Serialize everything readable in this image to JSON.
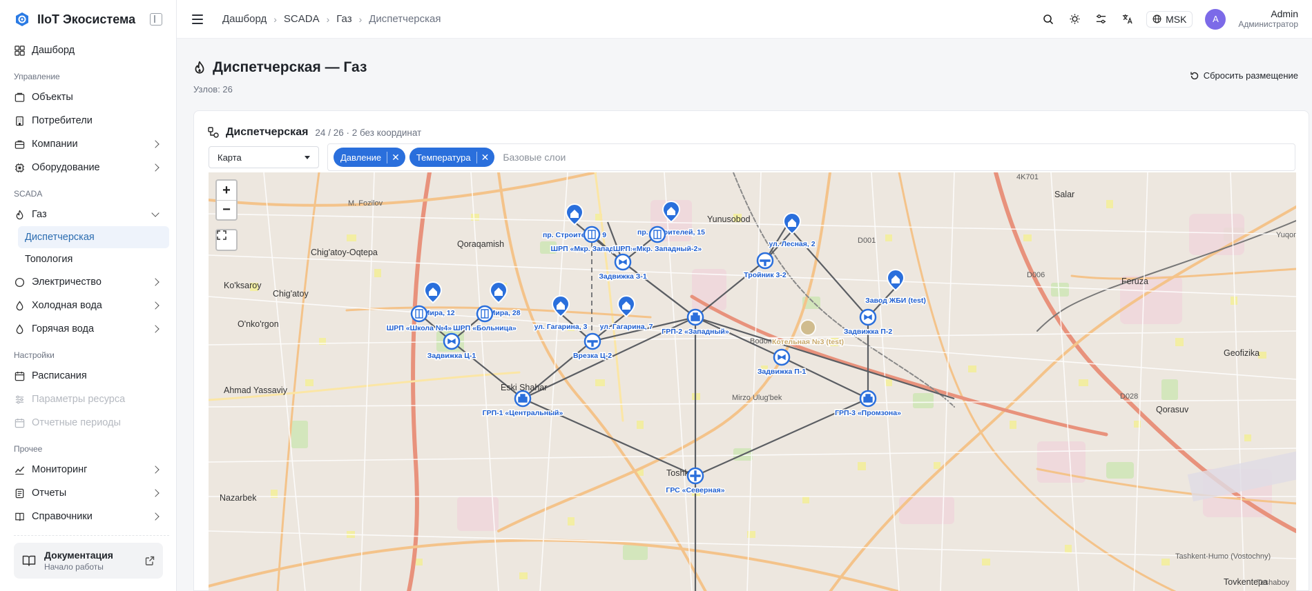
{
  "app": {
    "title": "IIoT Экосистема"
  },
  "sidebar": {
    "dashboard": "Дашборд",
    "sections": {
      "manage": "Управление",
      "scada": "SCADA",
      "settings": "Настройки",
      "other": "Прочее"
    },
    "manage_items": [
      "Объекты",
      "Потребители",
      "Компании",
      "Оборудование"
    ],
    "scada_items": {
      "gas": "Газ",
      "gas_sub": [
        "Диспетчерская",
        "Топология"
      ],
      "electricity": "Электричество",
      "cold_water": "Холодная вода",
      "hot_water": "Горячая вода"
    },
    "settings_items": [
      "Расписания",
      "Параметры ресурса",
      "Отчетные периоды"
    ],
    "other_items": [
      "Мониторинг",
      "Отчеты",
      "Справочники"
    ],
    "doc": {
      "title": "Документация",
      "subtitle": "Начало работы"
    }
  },
  "topbar": {
    "breadcrumbs": [
      "Дашборд",
      "SCADA",
      "Газ",
      "Диспетчерская"
    ],
    "timezone": "MSK",
    "user": {
      "initial": "A",
      "name": "Admin",
      "role": "Администратор"
    }
  },
  "page": {
    "title": "Диспетчерская — Газ",
    "subtitle": "Узлов: 26",
    "reset_label": "Сбросить размещение"
  },
  "card": {
    "title": "Диспетчерская",
    "meta": "24 / 26 · 2 без координат",
    "view_select": "Карта",
    "tags": [
      "Давление",
      "Температура"
    ],
    "layers_placeholder": "Базовые слои"
  },
  "map": {
    "zoom_in": "+",
    "zoom_out": "−",
    "nodes": [
      {
        "label": "пр. Строителей, 9",
        "type": "house"
      },
      {
        "label": "ШРП «Мкр. Западный»",
        "type": "cabinet"
      },
      {
        "label": "пр. Строителей, 15",
        "type": "house"
      },
      {
        "label": "ШРП «Мкр. Западный-2»",
        "type": "cabinet"
      },
      {
        "label": "Задвижка З-1",
        "type": "valve"
      },
      {
        "label": "ул. Лесная, 2",
        "type": "house"
      },
      {
        "label": "Тройник 3-2",
        "type": "tee"
      },
      {
        "label": "Завод ЖБИ (test)",
        "type": "house"
      },
      {
        "label": "Задвижка П-2",
        "type": "valve"
      },
      {
        "label": "ул. Мира, 12",
        "type": "house"
      },
      {
        "label": "ШРП «Школа №4»",
        "type": "cabinet"
      },
      {
        "label": "ул. Мира, 28",
        "type": "house"
      },
      {
        "label": "ШРП «Больница»",
        "type": "cabinet"
      },
      {
        "label": "ул. Гагарина, 3",
        "type": "house"
      },
      {
        "label": "ул. Гагарина, 7",
        "type": "house"
      },
      {
        "label": "ГРП-2 «Западный»",
        "type": "grp"
      },
      {
        "label": "Котельная №3 (test)",
        "type": "boiler"
      },
      {
        "label": "Задвижка Ц-1",
        "type": "valve"
      },
      {
        "label": "Врезка Ц-2",
        "type": "tee"
      },
      {
        "label": "Задвижка П-1",
        "type": "valve"
      },
      {
        "label": "ГРП-1 «Центральный»",
        "type": "grp"
      },
      {
        "label": "ГРП-3 «Промзона»",
        "type": "grp"
      },
      {
        "label": "ГРС «Северная»",
        "type": "grs"
      }
    ],
    "places": [
      {
        "name": "Salar"
      },
      {
        "name": "Yunusobod"
      },
      {
        "name": "Qoraqamish"
      },
      {
        "name": "Chig'atoy-Oqtepa"
      },
      {
        "name": "Chig'atoy"
      },
      {
        "name": "Ko'ksaroy"
      },
      {
        "name": "O'nko'rgon"
      },
      {
        "name": "Ahmad Yassaviy"
      },
      {
        "name": "Feruza"
      },
      {
        "name": "Geofizika"
      },
      {
        "name": "Qorasuv"
      },
      {
        "name": "Eski Shahar"
      },
      {
        "name": "Toshkent"
      },
      {
        "name": "Nazarbek"
      },
      {
        "name": "Tovkentepa"
      },
      {
        "name": "M. Fozilov"
      },
      {
        "name": "D001"
      },
      {
        "name": "D006"
      },
      {
        "name": "D028"
      },
      {
        "name": "4K701"
      },
      {
        "name": "Yuqori"
      },
      {
        "name": "Teshaboy"
      },
      {
        "name": "Mirzo Ulug'bek"
      },
      {
        "name": "Bodomzor"
      },
      {
        "name": "Tashkent-Humo (Vostochny)"
      }
    ]
  }
}
